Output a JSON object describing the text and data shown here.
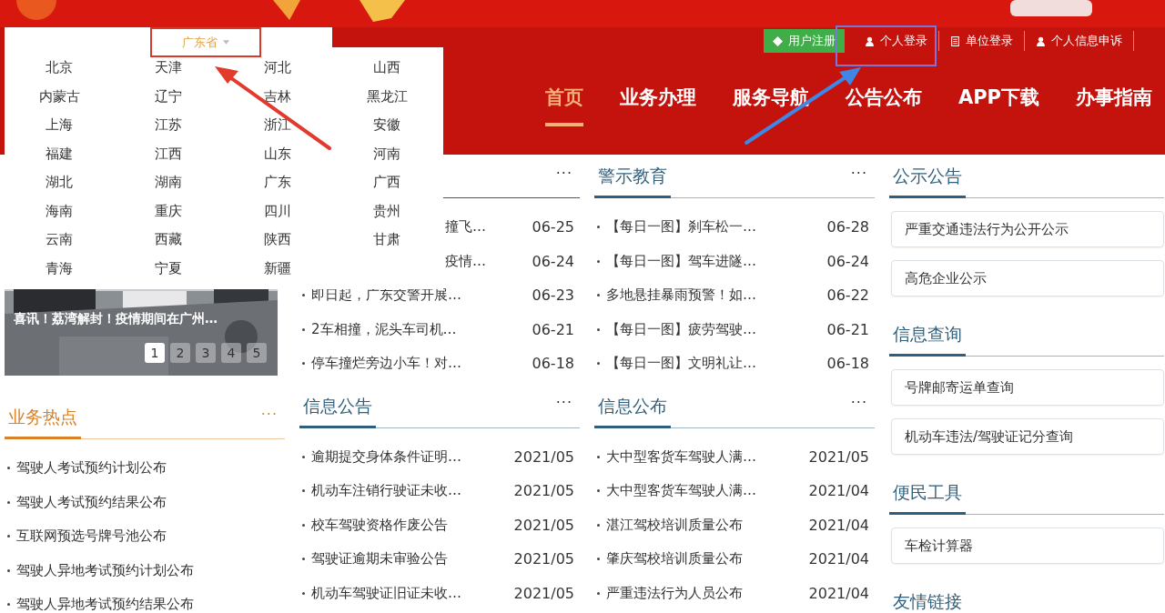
{
  "header": {
    "top_links": [
      {
        "label": "用户注册",
        "kind": "register"
      },
      {
        "label": "个人登录",
        "kind": "person"
      },
      {
        "label": "单位登录",
        "kind": "unit"
      },
      {
        "label": "个人信息申诉",
        "kind": "person"
      }
    ],
    "nav": [
      {
        "label": "首页",
        "selected": true
      },
      {
        "label": "业务办理",
        "selected": false
      },
      {
        "label": "服务导航",
        "selected": false
      },
      {
        "label": "公告公布",
        "selected": false
      },
      {
        "label": "APP下载",
        "selected": false
      },
      {
        "label": "办事指南",
        "selected": false
      }
    ]
  },
  "province_dropdown": {
    "value": "广东省",
    "options": [
      "北京",
      "天津",
      "河北",
      "山西",
      "内蒙古",
      "辽宁",
      "吉林",
      "黑龙江",
      "上海",
      "江苏",
      "浙江",
      "安徽",
      "福建",
      "江西",
      "山东",
      "河南",
      "湖北",
      "湖南",
      "广东",
      "广西",
      "海南",
      "重庆",
      "四川",
      "贵州",
      "云南",
      "西藏",
      "陕西",
      "甘肃",
      "青海",
      "宁夏",
      "新疆"
    ]
  },
  "carousel": {
    "caption": "喜讯！荔湾解封！疫情期间在广州…",
    "pages": [
      {
        "label": "1",
        "selected": true
      },
      {
        "label": "2",
        "selected": false
      },
      {
        "label": "3",
        "selected": false
      },
      {
        "label": "4",
        "selected": false
      },
      {
        "label": "5",
        "selected": false
      }
    ]
  },
  "columns": [
    {
      "sections": [
        {
          "kind": "carousel"
        },
        {
          "kind": "list",
          "title": "业务热点",
          "color": "#d9822b",
          "more": "···",
          "items": [
            {
              "title": "驾驶人考试预约计划公布",
              "covered": false
            },
            {
              "title": "驾驶人考试预约结果公布",
              "covered": false
            },
            {
              "title": "互联网预选号牌号池公布",
              "covered": false
            },
            {
              "title": "驾驶人异地考试预约计划公布",
              "covered": false
            },
            {
              "title": "驾驶人异地考试预约结果公布",
              "covered": false
            }
          ]
        }
      ]
    },
    {
      "sections": [
        {
          "kind": "list",
          "color": "#2f5f7c",
          "more": "···",
          "items": [
            {
              "title": "撞飞…",
              "date": "06-25",
              "covered": true
            },
            {
              "title": "疫情…",
              "date": "06-24",
              "covered": true
            },
            {
              "title": "即日起，广东交警开展…",
              "date": "06-23",
              "covered": false
            },
            {
              "title": "2车相撞，泥头车司机…",
              "date": "06-21",
              "covered": false
            },
            {
              "title": "停车撞烂旁边小车！对…",
              "date": "06-18",
              "covered": false
            }
          ]
        },
        {
          "kind": "list",
          "title": "信息公告",
          "color": "#2f5f7c",
          "more": "···",
          "items": [
            {
              "title": "逾期提交身体条件证明…",
              "date": "2021/05",
              "covered": false
            },
            {
              "title": "机动车注销行驶证未收…",
              "date": "2021/05",
              "covered": false
            },
            {
              "title": "校车驾驶资格作废公告",
              "date": "2021/05",
              "covered": false
            },
            {
              "title": "驾驶证逾期未审验公告",
              "date": "2021/05",
              "covered": false
            },
            {
              "title": "机动车驾驶证旧证未收…",
              "date": "2021/05",
              "covered": false
            }
          ]
        }
      ]
    },
    {
      "sections": [
        {
          "kind": "list",
          "title": "警示教育",
          "color": "#2f5f7c",
          "more": "···",
          "items": [
            {
              "title": "【每日一图】刹车松一…",
              "date": "06-28",
              "covered": false
            },
            {
              "title": "【每日一图】驾车进隧…",
              "date": "06-24",
              "covered": false
            },
            {
              "title": "多地悬挂暴雨预警！如…",
              "date": "06-22",
              "covered": false
            },
            {
              "title": "【每日一图】疲劳驾驶…",
              "date": "06-21",
              "covered": false
            },
            {
              "title": "【每日一图】文明礼让…",
              "date": "06-18",
              "covered": false
            }
          ]
        },
        {
          "kind": "list",
          "title": "信息公布",
          "color": "#2f5f7c",
          "more": "···",
          "items": [
            {
              "title": "大中型客货车驾驶人满…",
              "date": "2021/05",
              "covered": false
            },
            {
              "title": "大中型客货车驾驶人满…",
              "date": "2021/04",
              "covered": false
            },
            {
              "title": "湛江驾校培训质量公布",
              "date": "2021/04",
              "covered": false
            },
            {
              "title": "肇庆驾校培训质量公布",
              "date": "2021/04",
              "covered": false
            },
            {
              "title": "严重违法行为人员公布",
              "date": "2021/04",
              "covered": false
            }
          ]
        }
      ]
    },
    {
      "sections": [
        {
          "kind": "cards",
          "title": "公示公告",
          "color": "#2f5f7c",
          "items": [
            "严重交通违法行为公开公示",
            "高危企业公示"
          ]
        },
        {
          "kind": "cards",
          "title": "信息查询",
          "color": "#2f5f7c",
          "items": [
            "号牌邮寄运单查询",
            "机动车违法/驾驶证记分查询"
          ]
        },
        {
          "kind": "cards",
          "title": "便民工具",
          "color": "#2f5f7c",
          "items": [
            "车检计算器"
          ]
        },
        {
          "kind": "cards",
          "title": "友情链接",
          "color": "#2f5f7c"
        }
      ]
    }
  ]
}
